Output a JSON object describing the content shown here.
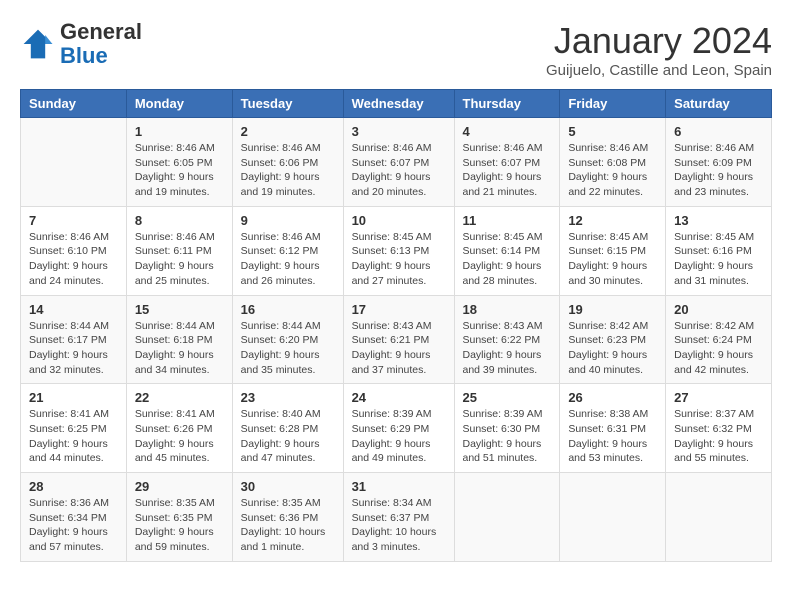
{
  "header": {
    "logo_general": "General",
    "logo_blue": "Blue",
    "month_title": "January 2024",
    "subtitle": "Guijuelo, Castille and Leon, Spain"
  },
  "days_of_week": [
    "Sunday",
    "Monday",
    "Tuesday",
    "Wednesday",
    "Thursday",
    "Friday",
    "Saturday"
  ],
  "weeks": [
    [
      {
        "day": "",
        "info": ""
      },
      {
        "day": "1",
        "info": "Sunrise: 8:46 AM\nSunset: 6:05 PM\nDaylight: 9 hours\nand 19 minutes."
      },
      {
        "day": "2",
        "info": "Sunrise: 8:46 AM\nSunset: 6:06 PM\nDaylight: 9 hours\nand 19 minutes."
      },
      {
        "day": "3",
        "info": "Sunrise: 8:46 AM\nSunset: 6:07 PM\nDaylight: 9 hours\nand 20 minutes."
      },
      {
        "day": "4",
        "info": "Sunrise: 8:46 AM\nSunset: 6:07 PM\nDaylight: 9 hours\nand 21 minutes."
      },
      {
        "day": "5",
        "info": "Sunrise: 8:46 AM\nSunset: 6:08 PM\nDaylight: 9 hours\nand 22 minutes."
      },
      {
        "day": "6",
        "info": "Sunrise: 8:46 AM\nSunset: 6:09 PM\nDaylight: 9 hours\nand 23 minutes."
      }
    ],
    [
      {
        "day": "7",
        "info": "Sunrise: 8:46 AM\nSunset: 6:10 PM\nDaylight: 9 hours\nand 24 minutes."
      },
      {
        "day": "8",
        "info": "Sunrise: 8:46 AM\nSunset: 6:11 PM\nDaylight: 9 hours\nand 25 minutes."
      },
      {
        "day": "9",
        "info": "Sunrise: 8:46 AM\nSunset: 6:12 PM\nDaylight: 9 hours\nand 26 minutes."
      },
      {
        "day": "10",
        "info": "Sunrise: 8:45 AM\nSunset: 6:13 PM\nDaylight: 9 hours\nand 27 minutes."
      },
      {
        "day": "11",
        "info": "Sunrise: 8:45 AM\nSunset: 6:14 PM\nDaylight: 9 hours\nand 28 minutes."
      },
      {
        "day": "12",
        "info": "Sunrise: 8:45 AM\nSunset: 6:15 PM\nDaylight: 9 hours\nand 30 minutes."
      },
      {
        "day": "13",
        "info": "Sunrise: 8:45 AM\nSunset: 6:16 PM\nDaylight: 9 hours\nand 31 minutes."
      }
    ],
    [
      {
        "day": "14",
        "info": "Sunrise: 8:44 AM\nSunset: 6:17 PM\nDaylight: 9 hours\nand 32 minutes."
      },
      {
        "day": "15",
        "info": "Sunrise: 8:44 AM\nSunset: 6:18 PM\nDaylight: 9 hours\nand 34 minutes."
      },
      {
        "day": "16",
        "info": "Sunrise: 8:44 AM\nSunset: 6:20 PM\nDaylight: 9 hours\nand 35 minutes."
      },
      {
        "day": "17",
        "info": "Sunrise: 8:43 AM\nSunset: 6:21 PM\nDaylight: 9 hours\nand 37 minutes."
      },
      {
        "day": "18",
        "info": "Sunrise: 8:43 AM\nSunset: 6:22 PM\nDaylight: 9 hours\nand 39 minutes."
      },
      {
        "day": "19",
        "info": "Sunrise: 8:42 AM\nSunset: 6:23 PM\nDaylight: 9 hours\nand 40 minutes."
      },
      {
        "day": "20",
        "info": "Sunrise: 8:42 AM\nSunset: 6:24 PM\nDaylight: 9 hours\nand 42 minutes."
      }
    ],
    [
      {
        "day": "21",
        "info": "Sunrise: 8:41 AM\nSunset: 6:25 PM\nDaylight: 9 hours\nand 44 minutes."
      },
      {
        "day": "22",
        "info": "Sunrise: 8:41 AM\nSunset: 6:26 PM\nDaylight: 9 hours\nand 45 minutes."
      },
      {
        "day": "23",
        "info": "Sunrise: 8:40 AM\nSunset: 6:28 PM\nDaylight: 9 hours\nand 47 minutes."
      },
      {
        "day": "24",
        "info": "Sunrise: 8:39 AM\nSunset: 6:29 PM\nDaylight: 9 hours\nand 49 minutes."
      },
      {
        "day": "25",
        "info": "Sunrise: 8:39 AM\nSunset: 6:30 PM\nDaylight: 9 hours\nand 51 minutes."
      },
      {
        "day": "26",
        "info": "Sunrise: 8:38 AM\nSunset: 6:31 PM\nDaylight: 9 hours\nand 53 minutes."
      },
      {
        "day": "27",
        "info": "Sunrise: 8:37 AM\nSunset: 6:32 PM\nDaylight: 9 hours\nand 55 minutes."
      }
    ],
    [
      {
        "day": "28",
        "info": "Sunrise: 8:36 AM\nSunset: 6:34 PM\nDaylight: 9 hours\nand 57 minutes."
      },
      {
        "day": "29",
        "info": "Sunrise: 8:35 AM\nSunset: 6:35 PM\nDaylight: 9 hours\nand 59 minutes."
      },
      {
        "day": "30",
        "info": "Sunrise: 8:35 AM\nSunset: 6:36 PM\nDaylight: 10 hours\nand 1 minute."
      },
      {
        "day": "31",
        "info": "Sunrise: 8:34 AM\nSunset: 6:37 PM\nDaylight: 10 hours\nand 3 minutes."
      },
      {
        "day": "",
        "info": ""
      },
      {
        "day": "",
        "info": ""
      },
      {
        "day": "",
        "info": ""
      }
    ]
  ]
}
